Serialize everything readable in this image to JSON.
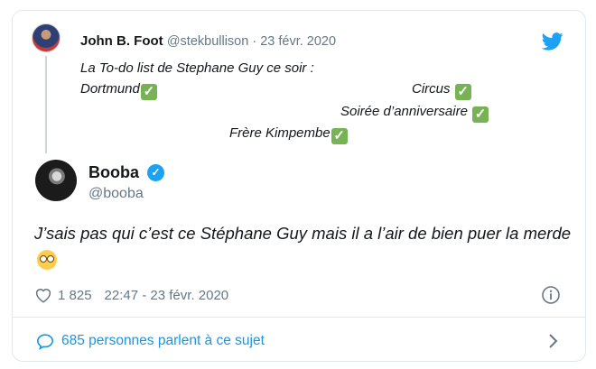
{
  "parent_tweet": {
    "name": "John B. Foot",
    "handle": "@stekbullison",
    "date_separator": " · ",
    "date": "23 févr. 2020",
    "lines": {
      "intro": "La To-do list de Stephane Guy ce soir :",
      "item_dortmund": "Dortmund",
      "item_circus": "Circus",
      "item_soiree": "Soirée d’anniversaire",
      "item_frere": "Frère Kimpembe"
    },
    "check_glyph": "✓"
  },
  "main_tweet": {
    "name": "Booba",
    "verified_glyph": "✓",
    "handle": "@booba",
    "text": "J’sais pas qui c’est ce Stéphane Guy mais il a l’air de bien puer la merde",
    "emoji": "flushed-face"
  },
  "stats": {
    "likes": "1 825",
    "timestamp": "22:47 - 23 févr. 2020"
  },
  "footer": {
    "conversation_label": "685 personnes parlent à ce sujet"
  },
  "colors": {
    "twitter_blue": "#1da1f2",
    "link_blue": "#1b95e0",
    "muted_gray": "#657786",
    "border": "#e1e8ed",
    "check_green": "#77b255"
  },
  "icons": [
    "twitter-bird-icon",
    "heart-icon",
    "info-icon",
    "speech-bubble-icon",
    "chevron-right-icon",
    "verified-badge-icon",
    "check-mark-icon"
  ]
}
